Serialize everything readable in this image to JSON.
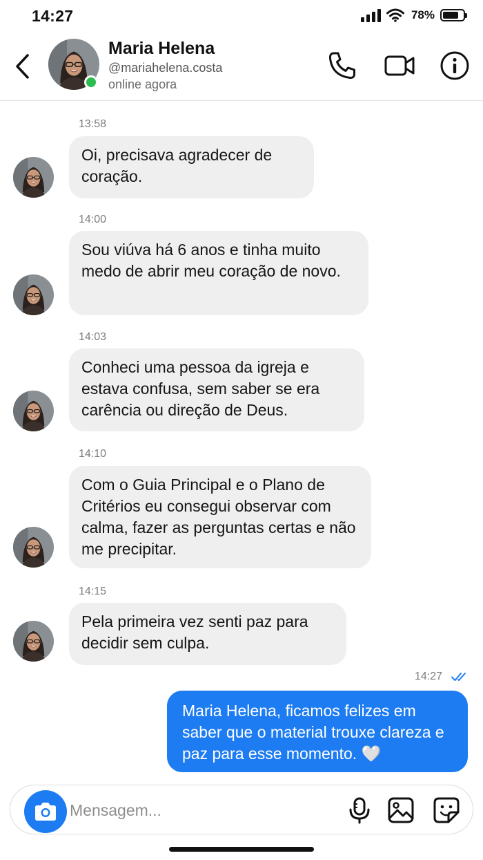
{
  "status_bar": {
    "time": "14:27",
    "battery": "78%",
    "battery_level": 0.78
  },
  "header": {
    "name": "Maria Helena",
    "handle": "@mariahelena.costa",
    "status": "online agora"
  },
  "messages": [
    {
      "time": "13:58",
      "text": "Oi, precisava agradecer de coração."
    },
    {
      "time": "14:00",
      "text": "Sou viúva há 6 anos e tinha muito medo de abrir meu coração de novo."
    },
    {
      "time": "14:03",
      "text": "Conheci uma pessoa da igreja e estava confusa, sem saber se era carência ou direção de Deus."
    },
    {
      "time": "14:10",
      "text": "Com o Guia Principal e o Plano de Critérios eu consegui observar com calma, fazer as perguntas certas e não me precipitar."
    },
    {
      "time": "14:15",
      "text": "Pela primeira vez senti paz para decidir sem culpa."
    }
  ],
  "reply": {
    "time": "14:27",
    "text": "Maria Helena, ficamos felizes em saber que o material trouxe clareza e paz para esse momento. 🤍"
  },
  "composer": {
    "placeholder": "Mensagem..."
  },
  "colors": {
    "accent": "#1e7cf2",
    "incoming_bubble": "#efeff0",
    "online": "#2dbd4e"
  },
  "icons": {
    "back": "chevron-left-icon",
    "call": "phone-icon",
    "video": "video-camera-icon",
    "info": "info-icon",
    "camera": "camera-icon",
    "mic": "microphone-icon",
    "image": "image-icon",
    "sticker": "sticker-icon",
    "receipt": "double-check-icon"
  }
}
